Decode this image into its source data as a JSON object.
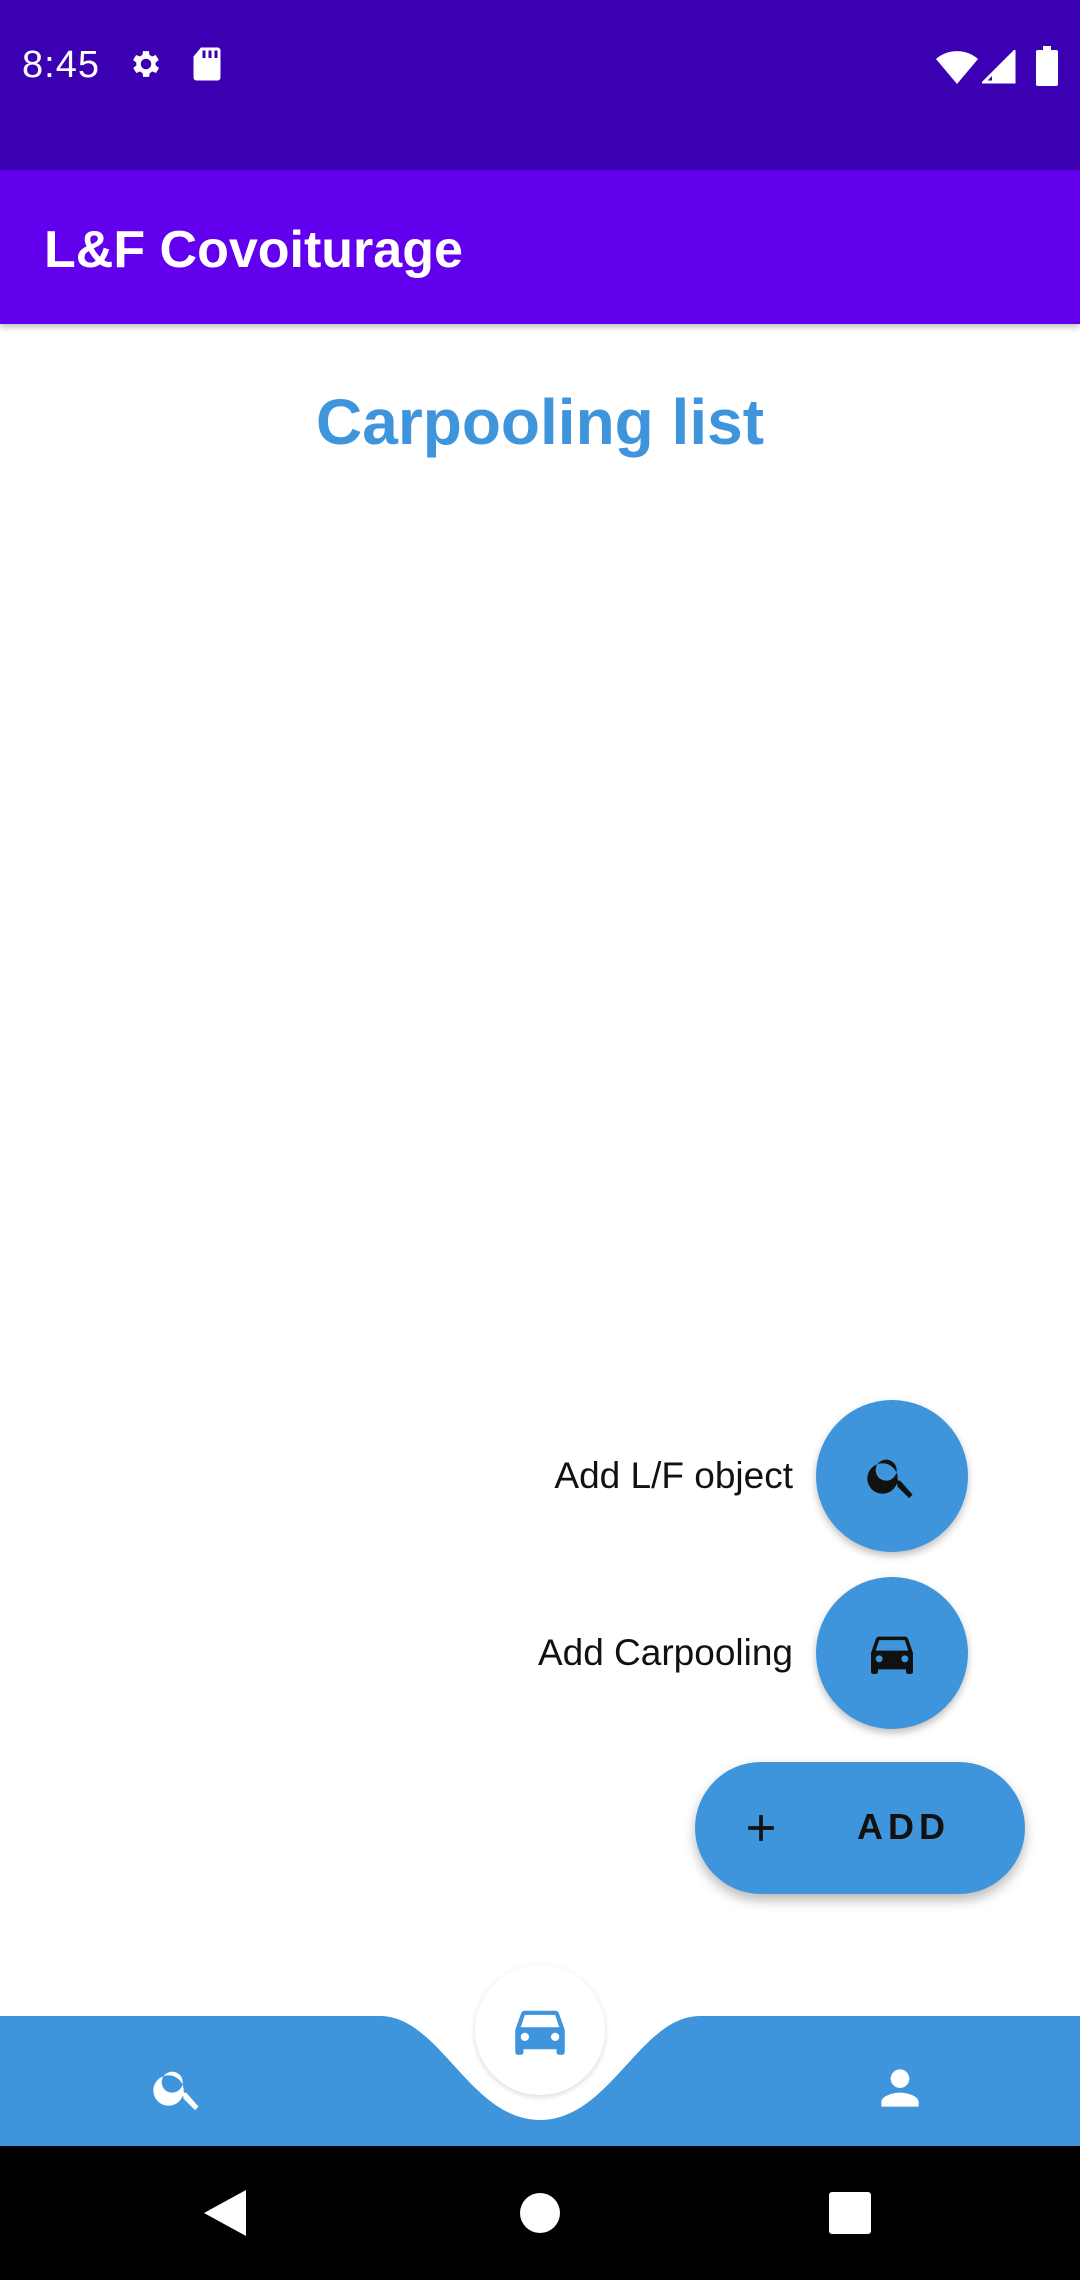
{
  "status_bar": {
    "time": "8:45",
    "icons_left": [
      "settings-icon",
      "sd-card-icon"
    ],
    "icons_right": [
      "wifi-icon",
      "cell-signal-icon",
      "battery-icon"
    ]
  },
  "app_bar": {
    "title": "L&F Covoiturage"
  },
  "main": {
    "title": "Carpooling list"
  },
  "fab_menu": {
    "items": [
      {
        "label": "Add L/F object",
        "icon": "search-icon"
      },
      {
        "label": "Add Carpooling",
        "icon": "car-icon"
      }
    ],
    "main_button": {
      "label": "ADD",
      "icon": "plus-icon"
    }
  },
  "bottom_nav": {
    "items": [
      {
        "icon": "search-icon"
      },
      {
        "icon": "car-icon",
        "selected": true
      },
      {
        "icon": "person-icon"
      }
    ]
  },
  "system_nav": {
    "buttons": [
      "back",
      "home",
      "recents"
    ]
  },
  "colors": {
    "status_bar": "#3c00b3",
    "app_bar": "#6200ee",
    "accent": "#3f95dc",
    "system_nav": "#000000"
  }
}
